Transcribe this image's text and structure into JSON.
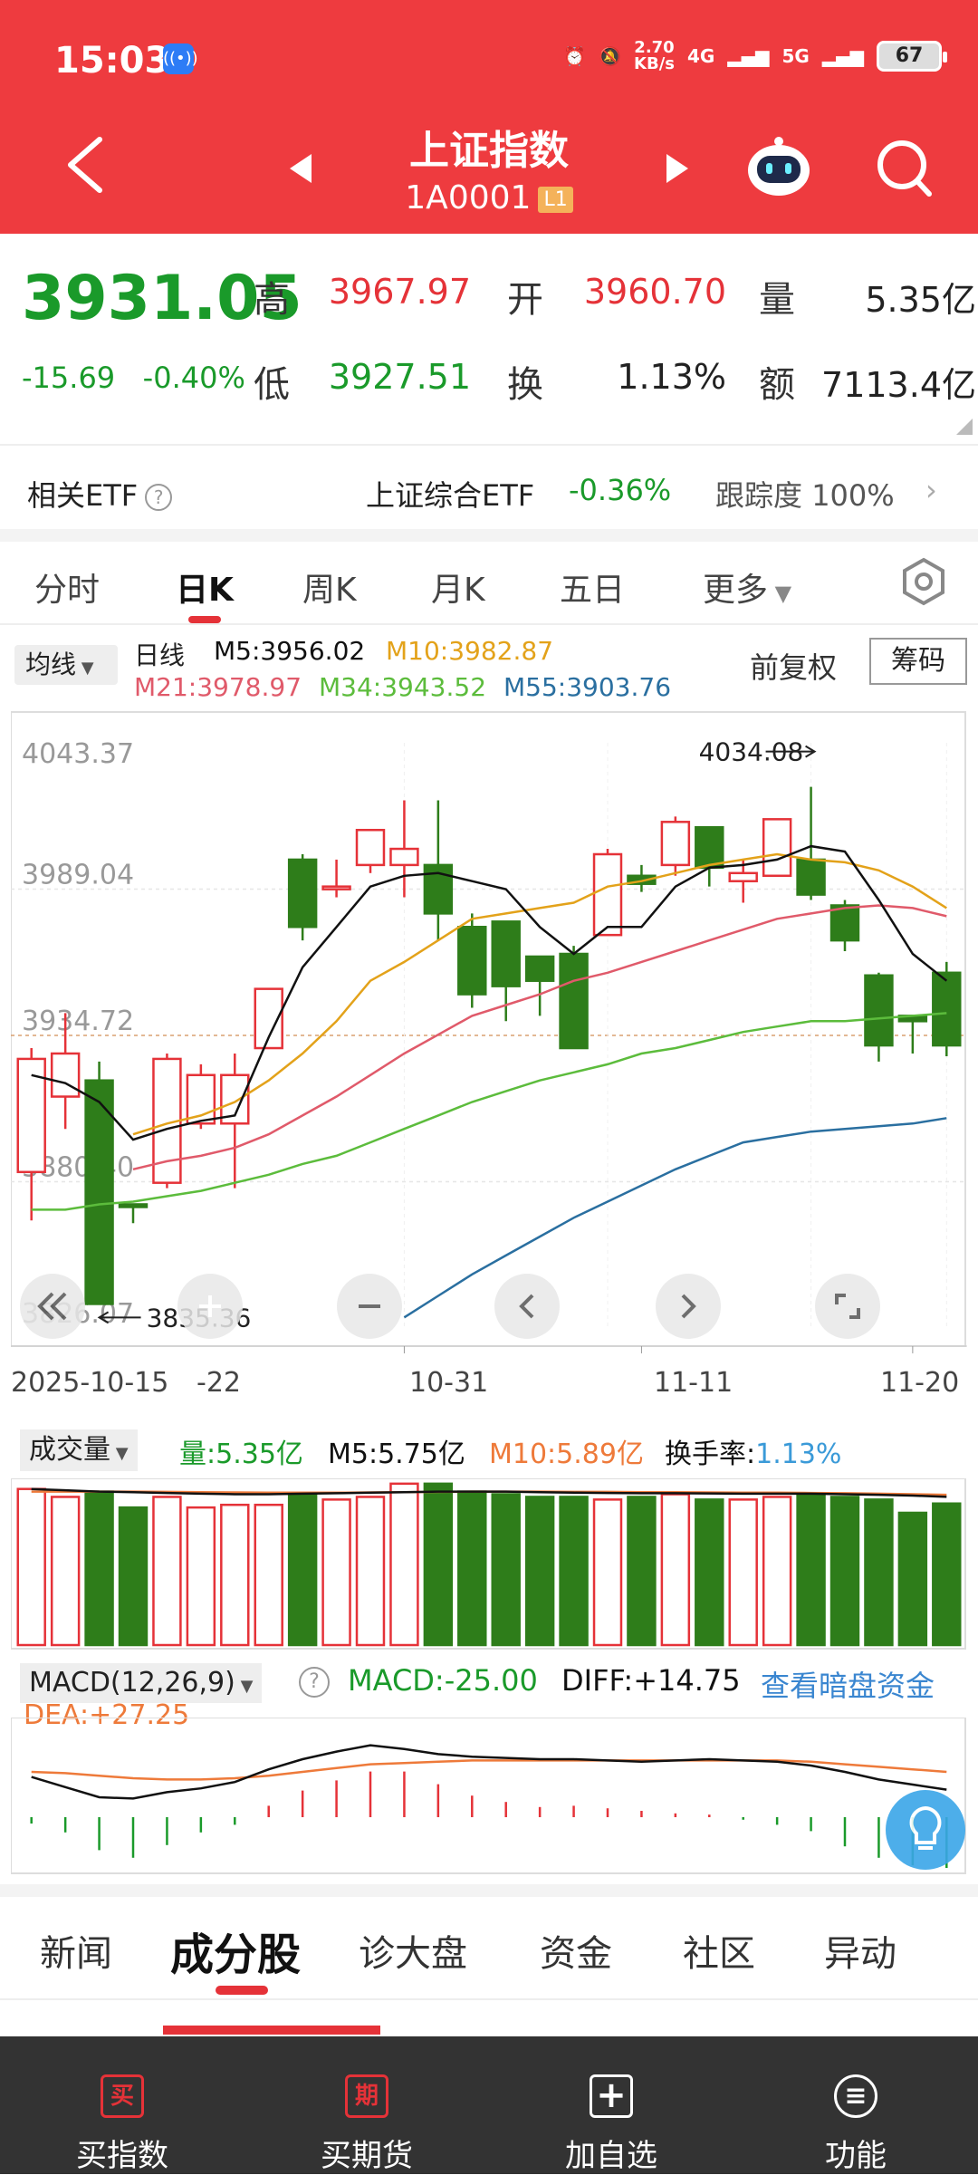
{
  "status_bar": {
    "time": "15:03",
    "net_speed": "2.70",
    "net_unit": "KB/s",
    "sig1": "4G",
    "sig2": "5G",
    "battery": "67"
  },
  "header": {
    "title": "上证指数",
    "code": "1A0001",
    "level": "L1"
  },
  "quote": {
    "price": "3931.05",
    "change": "-15.69",
    "change_pct": "-0.40%",
    "high_label": "高",
    "high": "3967.97",
    "open_label": "开",
    "open": "3960.70",
    "vol_label": "量",
    "vol": "5.35亿",
    "low_label": "低",
    "low": "3927.51",
    "turn_label": "换",
    "turn": "1.13%",
    "amt_label": "额",
    "amt": "7113.4亿"
  },
  "etf": {
    "label": "相关ETF",
    "help": "?",
    "name": "上证综合ETF",
    "change": "-0.36%",
    "track_label": "跟踪度",
    "track": "100%"
  },
  "period_tabs": [
    "分时",
    "日K",
    "周K",
    "月K",
    "五日",
    "更多"
  ],
  "active_period": "日K",
  "ma_bar": {
    "select": "均线",
    "type": "日线",
    "m5": "M5:3956.02",
    "m10": "M10:3982.87",
    "m21": "M21:3978.97",
    "m34": "M34:3943.52",
    "m55": "M55:3903.76",
    "fq": "前复权",
    "chip": "筹码"
  },
  "colors": {
    "up": "#e53238",
    "down": "#2e7d1a",
    "m5": "#111111",
    "m10": "#e3a21a",
    "m21": "#e05a6a",
    "m34": "#5cbc3c",
    "m55": "#2a6fa0"
  },
  "chart_data": [
    {
      "type": "candlestick",
      "y_ticks": [
        "4043.37",
        "3989.04",
        "3934.72",
        "3880.40",
        "3826.07"
      ],
      "ylim": [
        3826.07,
        4043.37
      ],
      "high_mark": "4034.08",
      "low_mark": "3835.36",
      "x_labels": [
        "2025-10-15",
        "-22",
        "10-31",
        "11-11",
        "11-20"
      ],
      "candles": [
        [
          3884,
          3926,
          3866,
          3930
        ],
        [
          3912,
          3928,
          3900,
          3943
        ],
        [
          3918,
          3835,
          3835,
          3925
        ],
        [
          3872,
          3871,
          3865,
          3872
        ],
        [
          3880,
          3926,
          3878,
          3928
        ],
        [
          3902,
          3920,
          3900,
          3924
        ],
        [
          3902,
          3920,
          3878,
          3928
        ],
        [
          3930,
          3952,
          3930,
          3952
        ],
        [
          4000,
          3975,
          3970,
          4002
        ],
        [
          3990,
          3990,
          3986,
          4000
        ],
        [
          3998,
          4011,
          3995,
          4011
        ],
        [
          3998,
          4004,
          3986,
          4022
        ],
        [
          3998,
          3980,
          3970,
          4022
        ],
        [
          3975,
          3950,
          3945,
          3980
        ],
        [
          3977,
          3953,
          3940,
          3977
        ],
        [
          3964,
          3955,
          3942,
          3964
        ],
        [
          3965,
          3930,
          3930,
          3968
        ],
        [
          3972,
          4002,
          3972,
          4004
        ],
        [
          3994,
          3991,
          3988,
          3998
        ],
        [
          3998,
          4014,
          3994,
          4016
        ],
        [
          4012,
          3997,
          3990,
          4012
        ],
        [
          3992,
          3995,
          3984,
          4000
        ],
        [
          3994,
          4015,
          3994,
          4015
        ],
        [
          4000,
          3987,
          3985,
          4027
        ],
        [
          3983,
          3970,
          3966,
          3985
        ],
        [
          3957,
          3931,
          3925,
          3958
        ],
        [
          3942,
          3940,
          3928,
          3942
        ],
        [
          3958,
          3931,
          3927,
          3962
        ]
      ],
      "ma5": [
        3920,
        3917,
        3910,
        3896,
        3900,
        3903,
        3905,
        3934,
        3960,
        3975,
        3990,
        3994,
        3995,
        3992,
        3989,
        3975,
        3965,
        3975,
        3975,
        3990,
        3997,
        3998,
        4000,
        4005,
        4003,
        3985,
        3965,
        3955
      ],
      "ma10": [
        null,
        null,
        null,
        3898,
        3902,
        3905,
        3910,
        3918,
        3928,
        3940,
        3955,
        3962,
        3970,
        3978,
        3980,
        3982,
        3984,
        3990,
        3992,
        3995,
        3998,
        4000,
        4002,
        4000,
        3999,
        3996,
        3990,
        3982
      ],
      "ma21": [
        null,
        null,
        null,
        3885,
        3888,
        3890,
        3893,
        3898,
        3905,
        3912,
        3920,
        3928,
        3935,
        3942,
        3946,
        3950,
        3955,
        3958,
        3962,
        3966,
        3970,
        3974,
        3978,
        3980,
        3982,
        3983,
        3982,
        3979
      ],
      "ma34": [
        3870,
        3870,
        3872,
        3873,
        3875,
        3877,
        3880,
        3883,
        3887,
        3890,
        3895,
        3900,
        3905,
        3910,
        3914,
        3918,
        3921,
        3924,
        3928,
        3930,
        3933,
        3936,
        3938,
        3940,
        3940,
        3941,
        3942,
        3943
      ],
      "ma55": [
        null,
        null,
        null,
        null,
        null,
        null,
        null,
        null,
        null,
        null,
        null,
        3830,
        3838,
        3846,
        3853,
        3860,
        3867,
        3873,
        3879,
        3885,
        3890,
        3895,
        3897,
        3899,
        3900,
        3901,
        3902,
        3904
      ]
    },
    {
      "type": "bar",
      "name": "成交量",
      "vals": [
        5.9,
        5.6,
        5.8,
        5.2,
        5.6,
        5.2,
        5.3,
        5.3,
        5.7,
        5.5,
        5.6,
        6.1,
        6.1,
        5.8,
        5.7,
        5.6,
        5.6,
        5.5,
        5.6,
        5.7,
        5.5,
        5.5,
        5.6,
        5.7,
        5.6,
        5.5,
        5.0,
        5.35
      ],
      "ma5": [
        5.9,
        5.85,
        5.8,
        5.78,
        5.75,
        5.72,
        5.7,
        5.7,
        5.72,
        5.74,
        5.76,
        5.78,
        5.8,
        5.8,
        5.8,
        5.78,
        5.76,
        5.75,
        5.74,
        5.74,
        5.73,
        5.72,
        5.72,
        5.72,
        5.7,
        5.68,
        5.65,
        5.6
      ],
      "ma10": [
        5.8,
        5.8,
        5.8,
        5.8,
        5.79,
        5.78,
        5.77,
        5.76,
        5.76,
        5.76,
        5.77,
        5.78,
        5.79,
        5.8,
        5.8,
        5.8,
        5.79,
        5.79,
        5.78,
        5.78,
        5.77,
        5.76,
        5.76,
        5.75,
        5.74,
        5.72,
        5.7,
        5.68
      ]
    },
    {
      "type": "macd",
      "macd": [
        -0.5,
        -1.2,
        -2.6,
        -3.2,
        -2.2,
        -1.2,
        -0.6,
        0.9,
        2.1,
        2.9,
        3.6,
        3.6,
        2.6,
        1.7,
        1.2,
        0.8,
        0.9,
        0.7,
        0.5,
        0.3,
        0.2,
        -0.2,
        -0.6,
        -1.1,
        -2.3,
        -3.2,
        -3.8,
        -4.0
      ],
      "diff": [
        2.0,
        1.2,
        0.4,
        0.3,
        0.8,
        1.1,
        1.6,
        2.6,
        3.4,
        4.0,
        4.5,
        4.2,
        3.8,
        3.6,
        3.5,
        3.4,
        3.4,
        3.3,
        3.2,
        3.3,
        3.4,
        3.3,
        3.2,
        2.9,
        2.4,
        1.8,
        1.4,
        1.0
      ],
      "dea": [
        2.4,
        2.3,
        2.1,
        1.9,
        1.8,
        1.8,
        1.9,
        2.1,
        2.4,
        2.7,
        3.0,
        3.1,
        3.2,
        3.3,
        3.3,
        3.3,
        3.3,
        3.3,
        3.3,
        3.3,
        3.3,
        3.3,
        3.3,
        3.2,
        3.0,
        2.8,
        2.6,
        2.4
      ]
    }
  ],
  "vol_bar": {
    "select": "成交量",
    "v": "量:5.35亿",
    "m5": "M5:5.75亿",
    "m10": "M10:5.89亿",
    "turn_label": "换手率:",
    "turn": "1.13%"
  },
  "macd_bar": {
    "select": "MACD(12,26,9)",
    "help": "?",
    "macd": "MACD:-25.00",
    "diff": "DIFF:+14.75",
    "link": "查看暗盘资金",
    "dea": "DEA:+27.25"
  },
  "news_tabs": [
    "新闻",
    "成分股",
    "诊大盘",
    "资金",
    "社区",
    "异动"
  ],
  "bottom_nav": [
    {
      "icon": "买",
      "label": "买指数"
    },
    {
      "icon": "期",
      "label": "买期货"
    },
    {
      "icon": "+",
      "label": "加自选"
    },
    {
      "icon": "≡",
      "label": "功能"
    }
  ]
}
